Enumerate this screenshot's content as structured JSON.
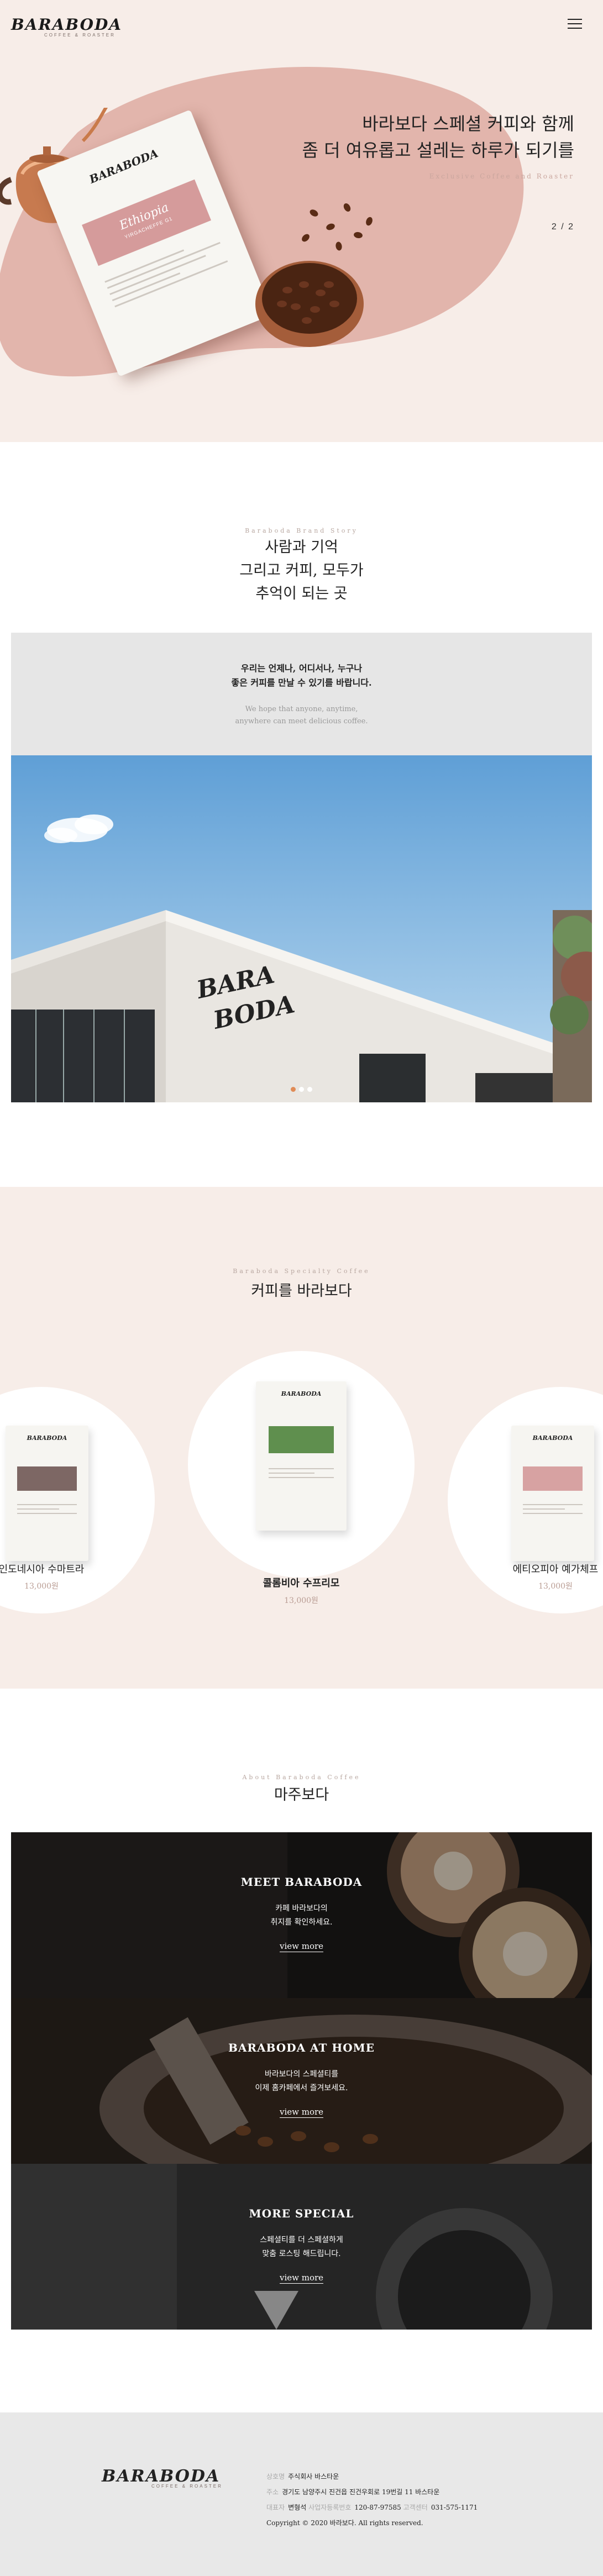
{
  "brand": {
    "name": "BARABODA",
    "sub": "COFFEE & ROASTER"
  },
  "hero": {
    "title_lines": [
      "바라보다 스페셜 커피와 함께",
      "좀 더 여유롭고 설레는 하루가 되기를"
    ],
    "subtitle": "Exclusive Coffee and Roaster",
    "pager": "2 / 2",
    "bag_logo": "BARABODA",
    "bag_name": "Ethiopia",
    "bag_note": "YIRGACHEFFE G1"
  },
  "about": {
    "eyebrow": "Baraboda Brand Story",
    "title_lines": [
      "사람과 기억",
      "그리고 커피, 모두가",
      "추억이 되는 곳"
    ],
    "ko_lines": [
      "우리는 언제나, 어디서나, 누구나",
      "좋은 커피를 만날 수 있기를 바랍니다."
    ],
    "en_lines": [
      "We hope that anyone, anytime,",
      "anywhere can meet delicious coffee."
    ]
  },
  "products": {
    "eyebrow": "Baraboda Specialty Coffee",
    "title": "커피를 바라보다",
    "items": [
      {
        "name": "인도네시아 수마트라",
        "price": "13,000원",
        "label_color": "#7d6764"
      },
      {
        "name": "콜롬비아 수프리모",
        "price": "13,000원",
        "label_color": "#5f8f4e"
      },
      {
        "name": "에티오피아 예가체프",
        "price": "13,000원",
        "label_color": "#d7a2a2"
      }
    ]
  },
  "story": {
    "eyebrow": "About Baraboda Coffee",
    "title": "마주보다",
    "cards": [
      {
        "title": "MEET BARABODA",
        "lines": [
          "카페 바라보다의",
          "취지를 확인하세요."
        ],
        "link": "view more"
      },
      {
        "title": "BARABODA AT HOME",
        "lines": [
          "바라보다의 스페셜티를",
          "이제 홈카페에서 즐겨보세요."
        ],
        "link": "view more"
      },
      {
        "title": "MORE SPECIAL",
        "lines": [
          "스페셜티를 더 스페셜하게",
          "맞춤 로스팅 해드립니다."
        ],
        "link": "view more"
      }
    ]
  },
  "footer": {
    "logo": "BARABODA",
    "logo_sub": "COFFEE & ROASTER",
    "company_k": "상호명",
    "company_v": "주식회사 바스타운",
    "addr_k": "주소",
    "addr_v": "경기도 남양주시 진건읍 진건우회로 19번길 11 바스타운",
    "ceo_k": "대표자",
    "ceo_v": "변형석",
    "biz_k": "사업자등록번호",
    "biz_v": "120-87-97585",
    "tel_k": "고객센터",
    "tel_v": "031-575-1171",
    "copyright": "Copyright © 2020 바라보다. All rights reserved."
  },
  "colors": {
    "blush": "#f7ede8",
    "blob": "#e0b3aa",
    "accent": "#e08c57"
  }
}
